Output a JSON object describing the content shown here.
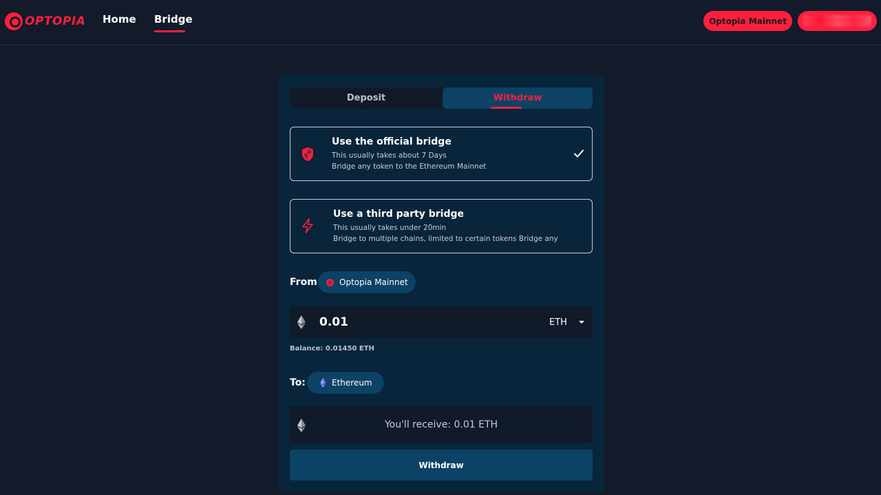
{
  "header": {
    "logo_text": "OPTOPIA",
    "nav": {
      "home": "Home",
      "bridge": "Bridge"
    },
    "network_button": "Optopia Mainnet"
  },
  "tabs": {
    "deposit": "Deposit",
    "withdraw": "Withdraw",
    "active": "Withdraw"
  },
  "options": [
    {
      "title": "Use the official bridge",
      "line1": "This usually takes about 7 Days",
      "line2": "Bridge any token to the Ethereum Mainnet",
      "icon": "shield-icon",
      "selected": true
    },
    {
      "title": "Use a third party bridge",
      "line1": "This usually takes under 20min",
      "line2": "Bridge to multiple chains, limited to certain tokens Bridge any",
      "icon": "lightning-icon",
      "selected": false
    }
  ],
  "from": {
    "label": "From",
    "network": "Optopia Mainnet"
  },
  "amount": {
    "value": "0.01",
    "token": "ETH"
  },
  "balance": "Balance: 0.01450 ETH",
  "to": {
    "label": "To:",
    "network": "Ethereum"
  },
  "receive": "You'll receive: 0.01 ETH",
  "action_button": "Withdraw",
  "colors": {
    "accent": "#ff1f3d",
    "background": "#131a2a",
    "card": "#08253b",
    "panel": "#0b4266"
  }
}
